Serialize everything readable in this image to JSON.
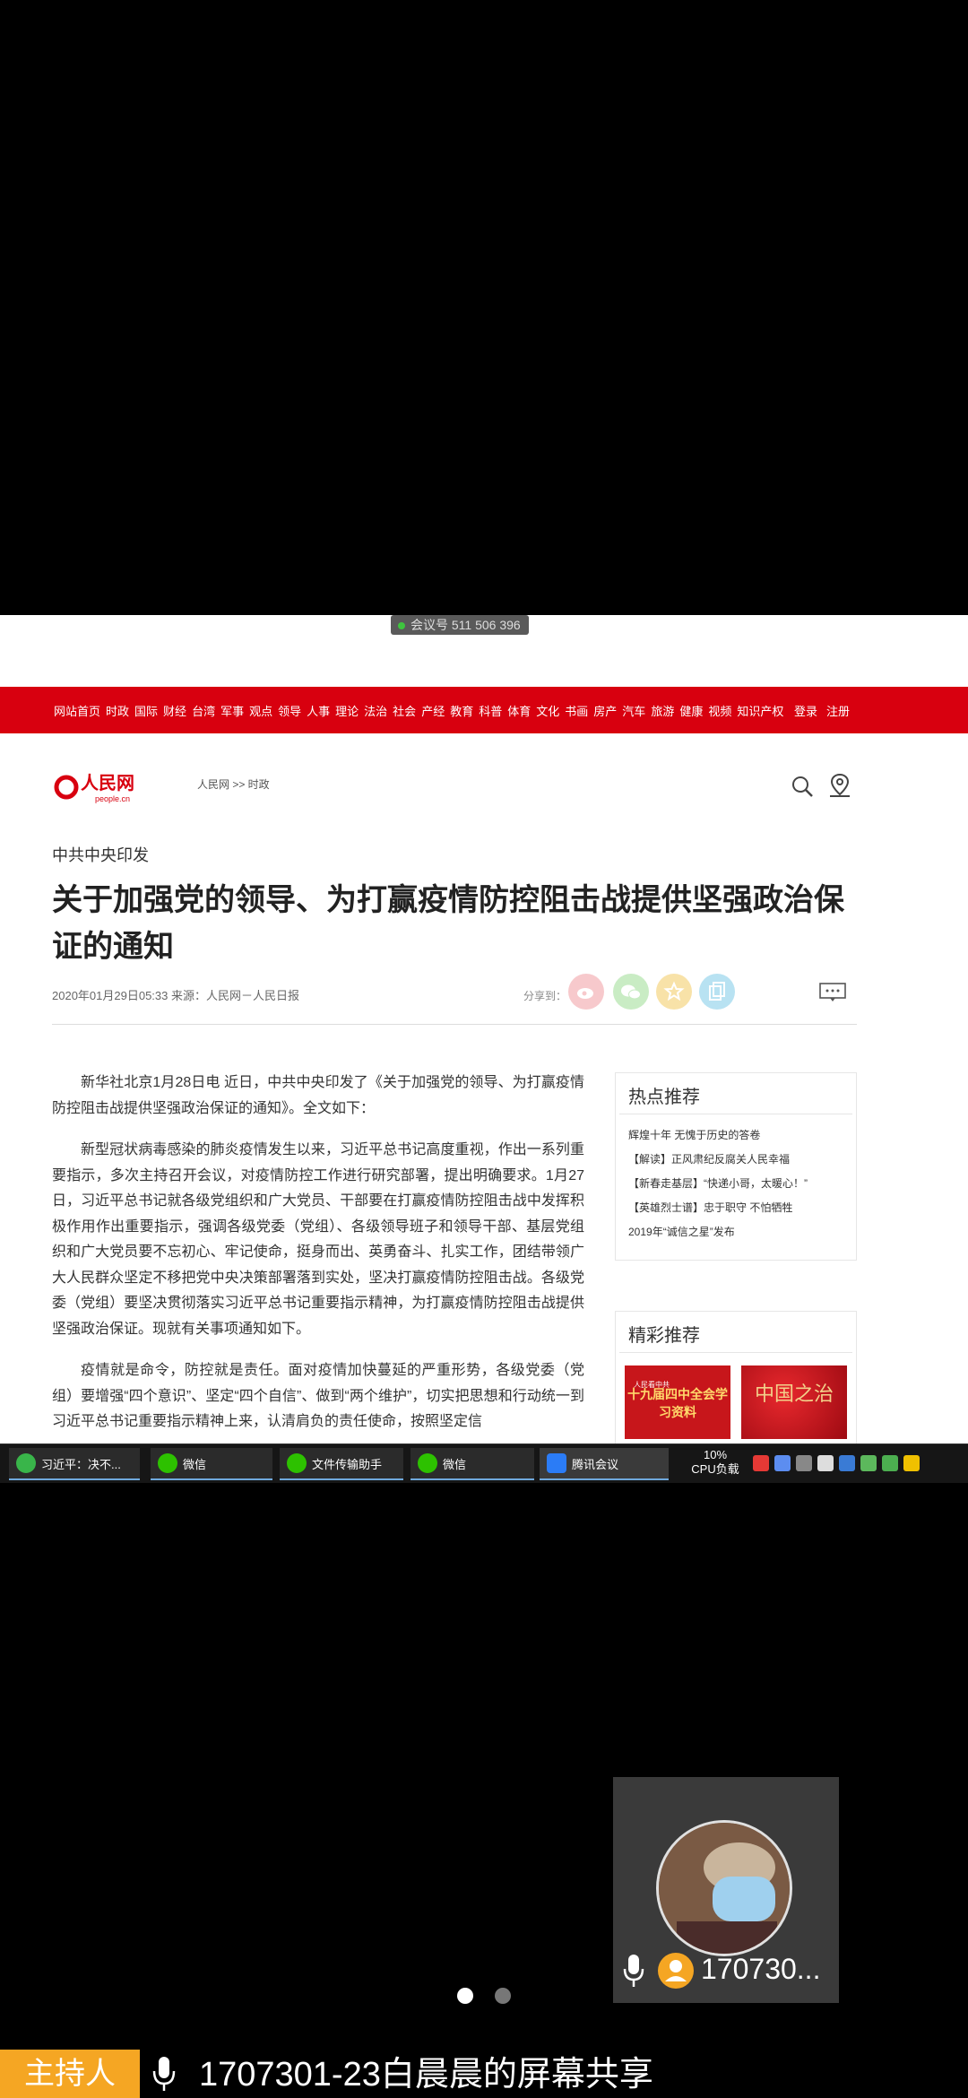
{
  "meeting_badge": "会议号 511 506 396",
  "nav": {
    "items": [
      "网站首页",
      "时政",
      "国际",
      "财经",
      "台湾",
      "军事",
      "观点",
      "领导",
      "人事",
      "理论",
      "法治",
      "社会",
      "产经",
      "教育",
      "科普",
      "体育",
      "文化",
      "书画",
      "房产",
      "汽车",
      "旅游",
      "健康",
      "视频",
      "知识产权"
    ],
    "login": "登录",
    "register": "注册"
  },
  "logo": {
    "text": "人民网",
    "sub": "people.cn"
  },
  "breadcrumb": "人民网 >> 时政",
  "article": {
    "kicker": "中共中央印发",
    "title": "关于加强党的领导、为打赢疫情防控阻击战提供坚强政治保证的通知",
    "meta": "2020年01月29日05:33  来源：人民网－人民日报",
    "share_label": "分享到：",
    "paragraphs": [
      "新华社北京1月28日电  近日，中共中央印发了《关于加强党的领导、为打赢疫情防控阻击战提供坚强政治保证的通知》。全文如下：",
      "新型冠状病毒感染的肺炎疫情发生以来，习近平总书记高度重视，作出一系列重要指示，多次主持召开会议，对疫情防控工作进行研究部署，提出明确要求。1月27日，习近平总书记就各级党组织和广大党员、干部要在打赢疫情防控阻击战中发挥积极作用作出重要指示，强调各级党委（党组）、各级领导班子和领导干部、基层党组织和广大党员要不忘初心、牢记使命，挺身而出、英勇奋斗、扎实工作，团结带领广大人民群众坚定不移把党中央决策部署落到实处，坚决打赢疫情防控阻击战。各级党委（党组）要坚决贯彻落实习近平总书记重要指示精神，为打赢疫情防控阻击战提供坚强政治保证。现就有关事项通知如下。",
      "疫情就是命令，防控就是责任。面对疫情加快蔓延的严重形势，各级党委（党组）要增强“四个意识”、坚定“四个自信”、做到“两个维护”，切实把思想和行动统一到习近平总书记重要指示精神上来，认清肩负的责任使命，按照坚定信"
    ]
  },
  "hot": {
    "heading": "热点推荐",
    "items": [
      "辉煌十年 无愧于历史的答卷",
      "【解读】正风肃纪反腐关人民幸福",
      "【新春走基层】“快递小哥，太暖心！”",
      "【英雄烈士谱】忠于职守 不怕牺牲",
      "2019年“诚信之星”发布"
    ]
  },
  "picks": {
    "heading": "精彩推荐",
    "img1_small": "人民看中共",
    "img1_text": "十九届四中全会学习资料",
    "img2_text": "中国之治"
  },
  "taskbar": {
    "tasks": [
      "习近平：决不...",
      "微信",
      "文件传输助手",
      "微信",
      "腾讯会议"
    ],
    "cpu_percent": "10%",
    "cpu_label": "CPU负载"
  },
  "participant": {
    "name": "170730..."
  },
  "bottom": {
    "host": "主持人",
    "title": "1707301-23白晨晨的屏幕共享"
  },
  "colors": {
    "nav_red": "#d8000f",
    "host_orange": "#f5a623"
  }
}
